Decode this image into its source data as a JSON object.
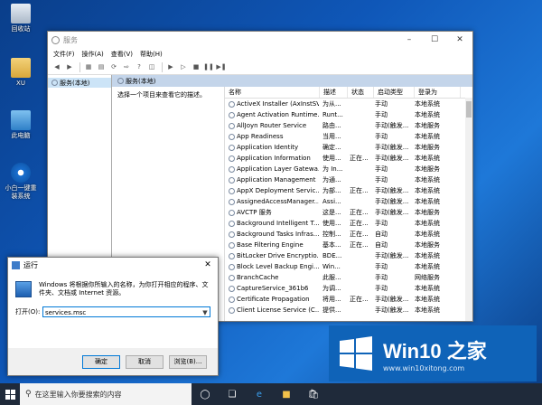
{
  "desktop": {
    "icons": [
      {
        "label": "回收站"
      },
      {
        "label": "XU"
      },
      {
        "label": "此电脑"
      },
      {
        "label": "小白一键重装系统"
      }
    ]
  },
  "services_window": {
    "title": "服务",
    "menu": [
      "文件(F)",
      "操作(A)",
      "查看(V)",
      "帮助(H)"
    ],
    "tree_item": "服务(本地)",
    "main_header": "服务(本地)",
    "description_hint": "选择一个项目来查看它的描述。",
    "columns": [
      "名称",
      "描述",
      "状态",
      "启动类型",
      "登录为"
    ],
    "rows": [
      [
        "ActiveX Installer (AxInstSV)",
        "为从...",
        "",
        "手动",
        "本地系统"
      ],
      [
        "Agent Activation Runtime...",
        "Runt...",
        "",
        "手动",
        "本地系统"
      ],
      [
        "AllJoyn Router Service",
        "路由...",
        "",
        "手动(触发...",
        "本地服务"
      ],
      [
        "App Readiness",
        "当用...",
        "",
        "手动",
        "本地系统"
      ],
      [
        "Application Identity",
        "确定...",
        "",
        "手动(触发...",
        "本地服务"
      ],
      [
        "Application Information",
        "使用...",
        "正在...",
        "手动(触发...",
        "本地系统"
      ],
      [
        "Application Layer Gatewa...",
        "为 In...",
        "",
        "手动",
        "本地服务"
      ],
      [
        "Application Management",
        "为通...",
        "",
        "手动",
        "本地系统"
      ],
      [
        "AppX Deployment Servic...",
        "为部...",
        "正在...",
        "手动(触发...",
        "本地系统"
      ],
      [
        "AssignedAccessManager...",
        "Assi...",
        "",
        "手动(触发...",
        "本地系统"
      ],
      [
        "AVCTP 服务",
        "这是...",
        "正在...",
        "手动(触发...",
        "本地服务"
      ],
      [
        "Background Intelligent T...",
        "使用...",
        "正在...",
        "手动",
        "本地系统"
      ],
      [
        "Background Tasks Infras...",
        "控制...",
        "正在...",
        "自动",
        "本地系统"
      ],
      [
        "Base Filtering Engine",
        "基本...",
        "正在...",
        "自动",
        "本地服务"
      ],
      [
        "BitLocker Drive Encryptio...",
        "BDE...",
        "",
        "手动(触发...",
        "本地系统"
      ],
      [
        "Block Level Backup Engi...",
        "Win...",
        "",
        "手动",
        "本地系统"
      ],
      [
        "BranchCache",
        "此服...",
        "",
        "手动",
        "网络服务"
      ],
      [
        "CaptureService_361b6",
        "为调...",
        "",
        "手动",
        "本地系统"
      ],
      [
        "Certificate Propagation",
        "将用...",
        "正在...",
        "手动(触发...",
        "本地系统"
      ],
      [
        "Client License Service (C...",
        "提供...",
        "",
        "手动(触发...",
        "本地系统"
      ]
    ]
  },
  "run_dialog": {
    "title": "运行",
    "description": "Windows 将根据你所输入的名称，为你打开相应的程序、文件夹、文档或 Internet 资源。",
    "open_label": "打开(O):",
    "input_value": "services.msc",
    "buttons": {
      "ok": "确定",
      "cancel": "取消",
      "browse": "浏览(B)..."
    }
  },
  "taskbar": {
    "search_placeholder": "在这里输入你要搜索的内容"
  },
  "watermark": {
    "brand": "Win10 之家",
    "url": "www.win10xitong.com"
  },
  "colors": {
    "accent": "#0078d7",
    "taskbar": "#1f2a3a",
    "list_header": "#c4d5ea"
  }
}
